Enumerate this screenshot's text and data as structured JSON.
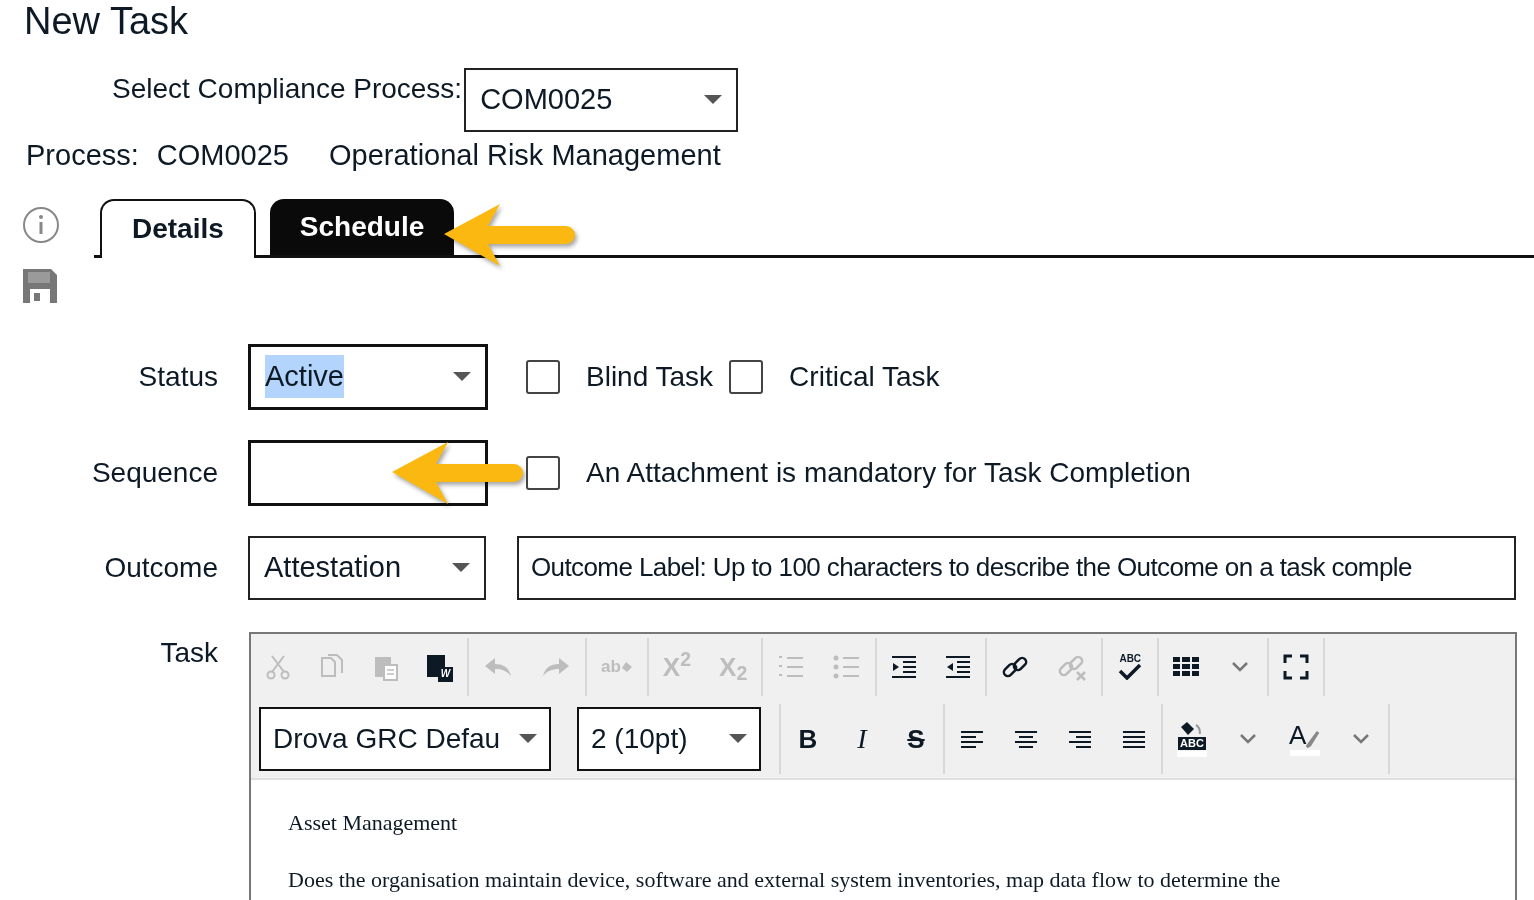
{
  "title": "New Task",
  "compliance": {
    "label": "Select Compliance Process:",
    "value": "COM0025"
  },
  "process": {
    "label": "Process:",
    "code": "COM0025",
    "name": "Operational Risk Management"
  },
  "tabs": [
    {
      "label": "Details",
      "selected": true
    },
    {
      "label": "Schedule",
      "selected": false
    }
  ],
  "form": {
    "status": {
      "label": "Status",
      "value": "Active",
      "highlighted": true
    },
    "blind_task": {
      "label": "Blind Task",
      "checked": false
    },
    "critical_task": {
      "label": "Critical Task",
      "checked": false
    },
    "sequence": {
      "label": "Sequence"
    },
    "attachment_mandatory": {
      "label": "An Attachment is mandatory for Task Completion",
      "checked": false
    },
    "outcome": {
      "label": "Outcome",
      "value": "Attestation",
      "outcome_label": "Outcome Label: Up to 100 characters to describe the Outcome on a task comple"
    },
    "task": {
      "label": "Task"
    }
  },
  "editor": {
    "toolbar_row_1": [
      [
        {
          "kind": "cut",
          "disabled": true
        },
        {
          "kind": "copy",
          "disabled": true
        },
        {
          "kind": "paste",
          "disabled": true
        },
        {
          "kind": "paste-word",
          "disabled": false,
          "label": "W"
        }
      ],
      [
        {
          "kind": "undo",
          "disabled": true
        },
        {
          "kind": "redo",
          "disabled": true
        }
      ],
      [
        {
          "kind": "clear-format",
          "disabled": true,
          "label": "ab"
        }
      ],
      [
        {
          "kind": "superscript",
          "disabled": true,
          "label": "X$^{2}$"
        },
        {
          "kind": "subscript",
          "disabled": true,
          "label": "X$_{2}$"
        }
      ],
      [
        {
          "kind": "ordered-list",
          "disabled": true
        },
        {
          "kind": "bullet-list",
          "disabled": true
        }
      ],
      [
        {
          "kind": "indent",
          "disabled": false
        },
        {
          "kind": "outdent",
          "disabled": false
        }
      ],
      [
        {
          "kind": "link",
          "disabled": false
        },
        {
          "kind": "unlink",
          "disabled": true
        }
      ],
      [
        {
          "kind": "spellcheck",
          "disabled": false,
          "label": "ABC"
        }
      ],
      [
        {
          "kind": "table",
          "disabled": false
        },
        {
          "kind": "caret"
        }
      ],
      [
        {
          "kind": "fullscreen",
          "disabled": false
        }
      ]
    ],
    "font": "Drova GRC Defau",
    "size": "2 (10pt)",
    "toolbar_row_2": [
      [
        {
          "kind": "bold",
          "disabled": false,
          "label": "B"
        },
        {
          "kind": "italic",
          "disabled": false,
          "label": "I"
        },
        {
          "kind": "strike",
          "disabled": false,
          "label": "S"
        }
      ],
      [
        {
          "kind": "align-left",
          "disabled": false
        },
        {
          "kind": "align-center",
          "disabled": false
        },
        {
          "kind": "align-right",
          "disabled": false
        },
        {
          "kind": "justify",
          "disabled": false
        }
      ],
      [
        {
          "kind": "bg-color",
          "disabled": false,
          "label": "ABC"
        },
        {
          "kind": "caret"
        },
        {
          "kind": "text-color",
          "disabled": false,
          "label": "A"
        },
        {
          "kind": "caret"
        }
      ]
    ],
    "content": [
      "Asset Management",
      "Does the organisation maintain device, software and external system inventories, map data flow to determine the"
    ]
  }
}
